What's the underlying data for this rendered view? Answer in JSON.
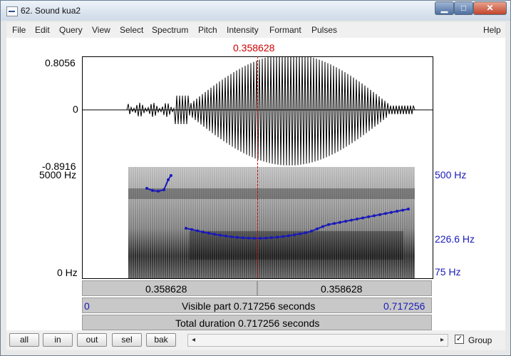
{
  "window": {
    "title": "62. Sound kua2",
    "controls": {
      "minimize": "▁",
      "maximize": "□",
      "close": "✕"
    }
  },
  "menu": [
    "File",
    "Edit",
    "Query",
    "View",
    "Select",
    "Spectrum",
    "Pitch",
    "Intensity",
    "Formant",
    "Pulses",
    "Help"
  ],
  "cursor": {
    "time": "0.358628"
  },
  "waveform": {
    "ymax": "0.8056",
    "zero": "0",
    "ymin": "-0.8916"
  },
  "spectrogram": {
    "freq_max": "5000 Hz",
    "freq_min": "0 Hz"
  },
  "pitch": {
    "max": "500 Hz",
    "current": "226.6 Hz",
    "min": "75 Hz"
  },
  "selection": {
    "left": "0.358628",
    "right": "0.358628"
  },
  "visible": {
    "start": "0",
    "label": "Visible part 0.717256 seconds",
    "end": "0.717256"
  },
  "total": {
    "label": "Total duration 0.717256 seconds"
  },
  "buttons": {
    "all": "all",
    "in": "in",
    "out": "out",
    "sel": "sel",
    "bak": "bak"
  },
  "group": {
    "label": "Group",
    "checked": true
  },
  "colors": {
    "cursor": "#d00000",
    "pitch": "#1a1ab8",
    "bars": "#c8c8c8"
  }
}
